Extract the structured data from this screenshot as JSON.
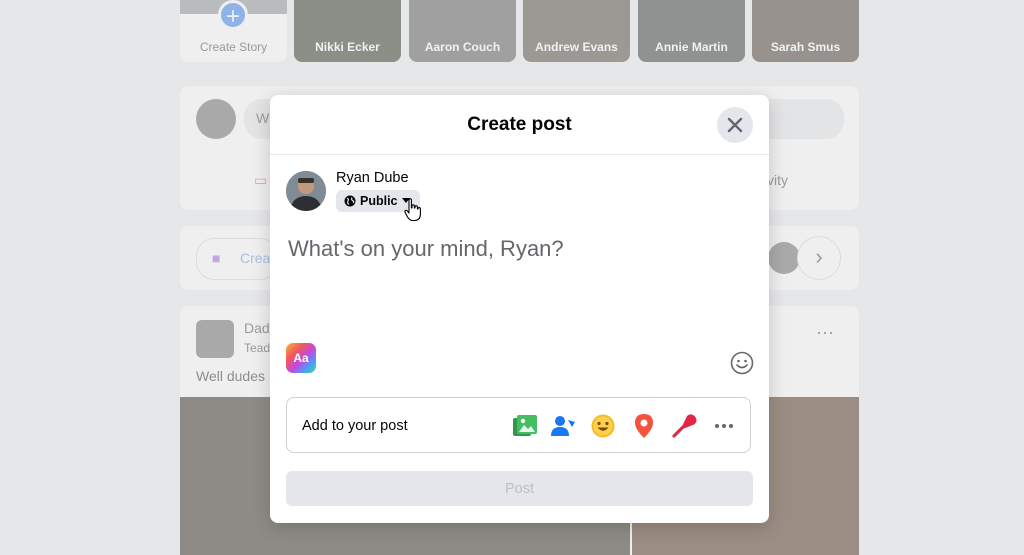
{
  "background": {
    "stories": [
      {
        "name": "Create Story"
      },
      {
        "name": "Nikki Ecker"
      },
      {
        "name": "Aaron Couch"
      },
      {
        "name": "Andrew Evans"
      },
      {
        "name": "Annie Martin"
      },
      {
        "name": "Sarah Smus"
      }
    ],
    "composer_prefix": "W",
    "activity_suffix": "tivity",
    "room_prefix": "Crea",
    "post_author_prefix": "Dad",
    "post_meta_prefix": "Tead",
    "post_text_prefix": "Well dudes"
  },
  "modal": {
    "title": "Create post",
    "user_name": "Ryan Dube",
    "privacy_label": "Public",
    "composer_placeholder": "What's on your mind, Ryan?",
    "text_format_label": "Aa",
    "add_to_post_label": "Add to your post",
    "add_icons": [
      "photo-video-icon",
      "tag-people-icon",
      "feeling-icon",
      "check-in-icon",
      "live-video-icon",
      "more-icon"
    ],
    "post_button_label": "Post"
  },
  "colors": {
    "photo_green": "#45bd62",
    "tag_blue": "#1877f2",
    "feeling_yellow": "#f7b928",
    "checkin_red": "#f5533d",
    "live_red": "#e42645",
    "disabled_text": "#bcc0c4"
  }
}
